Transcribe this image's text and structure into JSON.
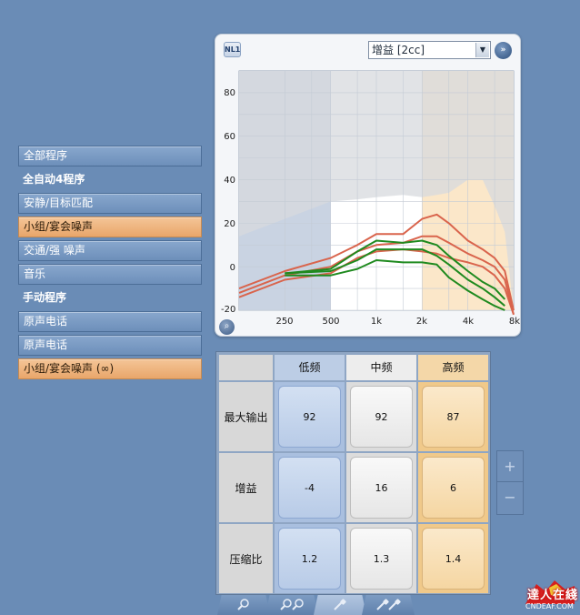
{
  "programs": {
    "all_programs": "全部程序",
    "auto_header": "全自动4程序",
    "auto_items": [
      "安静/目标匹配",
      "小组/宴会噪声",
      "交通/强 噪声",
      "音乐"
    ],
    "manual_header": "手动程序",
    "manual_items": [
      "原声电话",
      "原声电话",
      "小组/宴会噪声 (∞)"
    ],
    "selected_auto_index": 1,
    "selected_manual_index": 2
  },
  "graph": {
    "badge": "NL1",
    "curve_select": "增益 [2cc]",
    "y_ticks": [
      "80",
      "60",
      "40",
      "20",
      "0",
      "-20"
    ],
    "x_ticks": [
      "250",
      "500",
      "1k",
      "2k",
      "4k",
      "8k"
    ]
  },
  "chart_data": {
    "type": "line",
    "xlabel": "",
    "ylabel": "",
    "x_scale": "log",
    "xlim": [
      125,
      8000
    ],
    "ylim": [
      -20,
      90
    ],
    "x": [
      125,
      250,
      500,
      750,
      1000,
      1500,
      2000,
      2500,
      3000,
      4000,
      5000,
      6000,
      7000,
      8000
    ],
    "bands": [
      {
        "name": "low",
        "from": 125,
        "to": 500,
        "color": "#c9d3e2"
      },
      {
        "name": "mid",
        "from": 500,
        "to": 2000,
        "color": "#ffffff"
      },
      {
        "name": "high",
        "from": 2000,
        "to": 8000,
        "color": "#fbe7c9"
      }
    ],
    "series": [
      {
        "color": "#d9644c",
        "values": [
          -10,
          -2,
          4,
          10,
          15,
          15,
          22,
          24,
          20,
          12,
          8,
          4,
          -2,
          -20
        ]
      },
      {
        "color": "#d9644c",
        "values": [
          -12,
          -4,
          0,
          7,
          10,
          11,
          14,
          14,
          11,
          6,
          3,
          0,
          -6,
          -22
        ]
      },
      {
        "color": "#d9644c",
        "values": [
          -14,
          -6,
          -3,
          4,
          7,
          8,
          7,
          6,
          4,
          2,
          0,
          -4,
          -10,
          -22
        ]
      },
      {
        "color": "#1f8a1f",
        "values": [
          null,
          -3,
          -1,
          7,
          12,
          11,
          12,
          10,
          5,
          -2,
          -7,
          -10,
          -15,
          null
        ]
      },
      {
        "color": "#1f8a1f",
        "values": [
          null,
          -3,
          -2,
          3,
          8,
          8,
          8,
          5,
          1,
          -6,
          -10,
          -14,
          -18,
          null
        ]
      },
      {
        "color": "#1f8a1f",
        "values": [
          null,
          -4,
          -4,
          -1,
          3,
          2,
          2,
          1,
          -5,
          -11,
          -15,
          -18,
          -20,
          null
        ]
      }
    ],
    "max_output_area": {
      "color": "#d7d9de",
      "values": [
        14,
        22,
        30,
        31,
        32,
        33,
        32,
        33,
        34,
        40,
        40,
        28,
        16,
        -20
      ]
    }
  },
  "table": {
    "headers": {
      "low": "低频",
      "mid": "中频",
      "high": "高频"
    },
    "rows": [
      {
        "label": "最大输出",
        "low": "92",
        "mid": "92",
        "high": "87"
      },
      {
        "label": "增益",
        "low": "-4",
        "mid": "16",
        "high": "6"
      },
      {
        "label": "压缩比",
        "low": "1.2",
        "mid": "1.3",
        "high": "1.4"
      }
    ]
  },
  "stepper": {
    "plus": "+",
    "minus": "−"
  },
  "tabs": {
    "active_index": 2,
    "icons": [
      "zoom-icon",
      "double-zoom-icon",
      "probe-icon",
      "double-probe-icon"
    ]
  },
  "logo": {
    "text": "達人在綫",
    "sub": "CNDEAF.COM"
  }
}
